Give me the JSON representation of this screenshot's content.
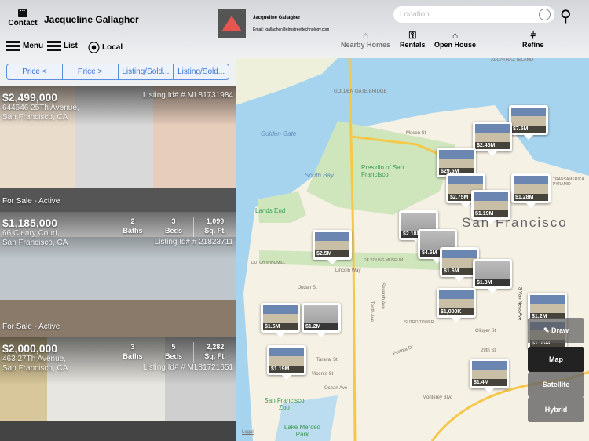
{
  "header": {
    "contact_label": "Contact",
    "user_name": "Jacqueline Gallagher",
    "agent_name": "Jacqueline Gallagher",
    "agent_email": "Email: jgallagher@elmstreettechnology.com",
    "menu_label": "Menu",
    "list_label": "List",
    "local_label": "Local",
    "search_placeholder": "Location"
  },
  "nav": [
    {
      "label": "Nearby Homes",
      "icon": "house-icon"
    },
    {
      "label": "Rentals",
      "icon": "rentals-icon"
    },
    {
      "label": "Open House",
      "icon": "open-house-icon"
    },
    {
      "label": "Refine",
      "icon": "sliders-icon"
    }
  ],
  "sort": [
    "Price <",
    "Price >",
    "Listing/Sold...",
    "Listing/Sold..."
  ],
  "listings": [
    {
      "price": "$2,499,000",
      "addr1": "644646 25Th Avenue,",
      "addr2": "San Francisco, CA",
      "listing_id": "Listing Id# # ML81731984",
      "status": "For Sale - Active"
    },
    {
      "price": "$1,185,000",
      "addr1": "66 Cleary Court,",
      "addr2": "San Francisco, CA",
      "baths": "2",
      "beds": "3",
      "sqft": "1,099",
      "baths_label": "Baths",
      "beds_label": "Beds",
      "sqft_label": "Sq. Ft.",
      "listing_id": "Listing Id# # 21823711",
      "status": "For Sale - Active"
    },
    {
      "price": "$2,000,000",
      "addr1": "463 27Th Avenue,",
      "addr2": "San Francisco, CA",
      "baths": "3",
      "beds": "5",
      "sqft": "2,282",
      "baths_label": "Baths",
      "beds_label": "Beds",
      "sqft_label": "Sq. Ft.",
      "listing_id": "Listing Id# # ML81721651"
    }
  ],
  "map": {
    "labels": [
      "GOLDEN GATE BRIDGE",
      "ALCATRAZ ISLAND",
      "Golden Gate",
      "South Bay",
      "Presidio of San Francisco",
      "Lands End",
      "San Francisco",
      "Mason St",
      "Lincoln Way",
      "DE YOUNG MUSEUM",
      "DUTCH WINDMILL",
      "Judah St",
      "Taraval St",
      "Vicente St",
      "Ocean Ave",
      "Monterey Blvd",
      "Portola Dr",
      "SUTRO TOWER",
      "Clipper St",
      "29th St",
      "San Francisco Zoo",
      "Lake Merced Park",
      "Seventh Ave",
      "Tenth Ave",
      "S Van Ness Ave",
      "Legal",
      "TRANSAMERICA PYRAMID"
    ],
    "markers": [
      "$7.5M",
      "$2.45M",
      "$29.5M",
      "$2.75M",
      "$1.28M",
      "$1.19M",
      "$2.18M",
      "$4.6M",
      "$2.5M",
      "$1.6M",
      "$1.3M",
      "$1,000K",
      "$1.6M",
      "$1.2M",
      "$1.19M",
      "$1.4M",
      "$1.2M",
      "$1.05M"
    ],
    "controls": {
      "draw": "Draw",
      "map": "Map",
      "satellite": "Satellite",
      "hybrid": "Hybrid"
    }
  }
}
